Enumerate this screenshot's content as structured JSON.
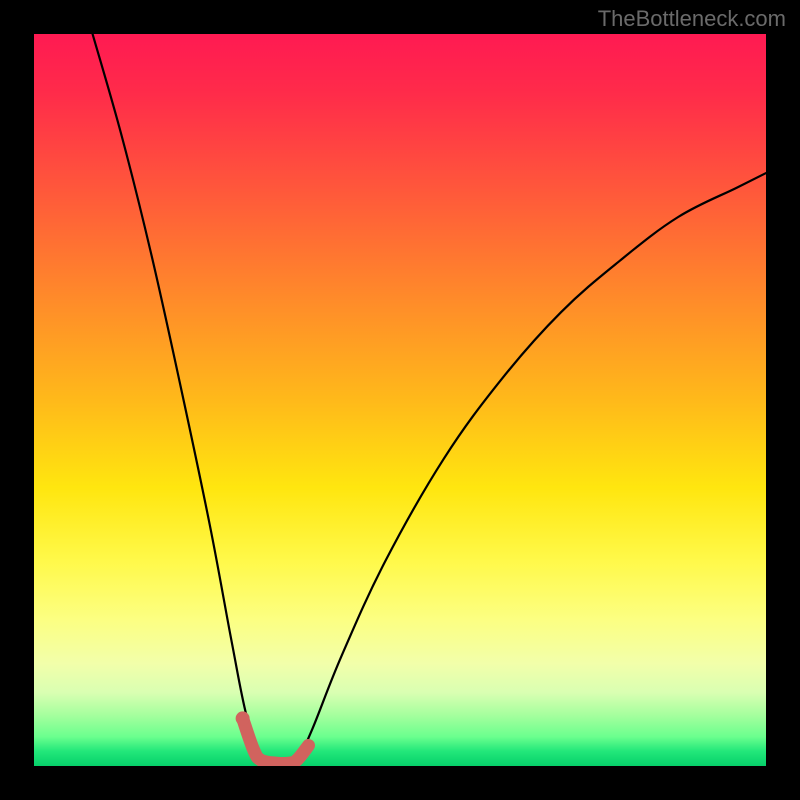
{
  "watermark": "TheBottleneck.com",
  "chart_data": {
    "type": "line",
    "title": "",
    "xlabel": "",
    "ylabel": "",
    "xlim": [
      0,
      100
    ],
    "ylim": [
      0,
      100
    ],
    "description": "Bottleneck curve over a vertical red-to-green gradient. Y≈100 means severe bottleneck (red zone at top), Y≈0 means no bottleneck (green zone at bottom). Minimum occurs around x≈31–36.",
    "series": [
      {
        "name": "bottleneck-curve",
        "x": [
          8,
          12,
          16,
          20,
          24,
          27,
          29,
          31,
          33,
          34,
          36,
          38,
          42,
          48,
          56,
          64,
          72,
          80,
          88,
          96,
          100
        ],
        "values": [
          100,
          86,
          70,
          52,
          33,
          17,
          7,
          1,
          0,
          0,
          1,
          5,
          15,
          28,
          42,
          53,
          62,
          69,
          75,
          79,
          81
        ]
      }
    ],
    "highlight": {
      "name": "optimal-band",
      "color": "#d1635e",
      "x": [
        28.5,
        30,
        31,
        33,
        35,
        36,
        37.5
      ],
      "values": [
        6.5,
        2.2,
        0.8,
        0.4,
        0.4,
        0.9,
        2.8
      ]
    },
    "highlight_dot": {
      "x": 28.5,
      "y": 6.5,
      "color": "#d1635e"
    }
  }
}
